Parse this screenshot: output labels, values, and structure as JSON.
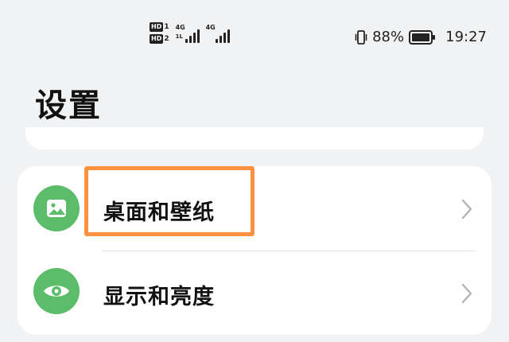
{
  "status_bar": {
    "sim1_badge": "HD",
    "sim1_number": "1",
    "sim2_badge": "HD",
    "sim2_number": "2",
    "sim1_network": "4G",
    "sim1_sub": "1L",
    "sim2_network": "4G",
    "battery_percent": "88%",
    "time": "19:27",
    "icons": [
      "vibrate-icon",
      "battery-icon",
      "signal-icon"
    ]
  },
  "page": {
    "title": "设置"
  },
  "settings": {
    "items": [
      {
        "label": "桌面和壁纸",
        "icon": "image-icon"
      },
      {
        "label": "显示和亮度",
        "icon": "eye-icon"
      }
    ]
  },
  "colors": {
    "background": "#f1f2f4",
    "card": "#ffffff",
    "icon_green": "#5bbd6a",
    "highlight": "#ff9140"
  }
}
